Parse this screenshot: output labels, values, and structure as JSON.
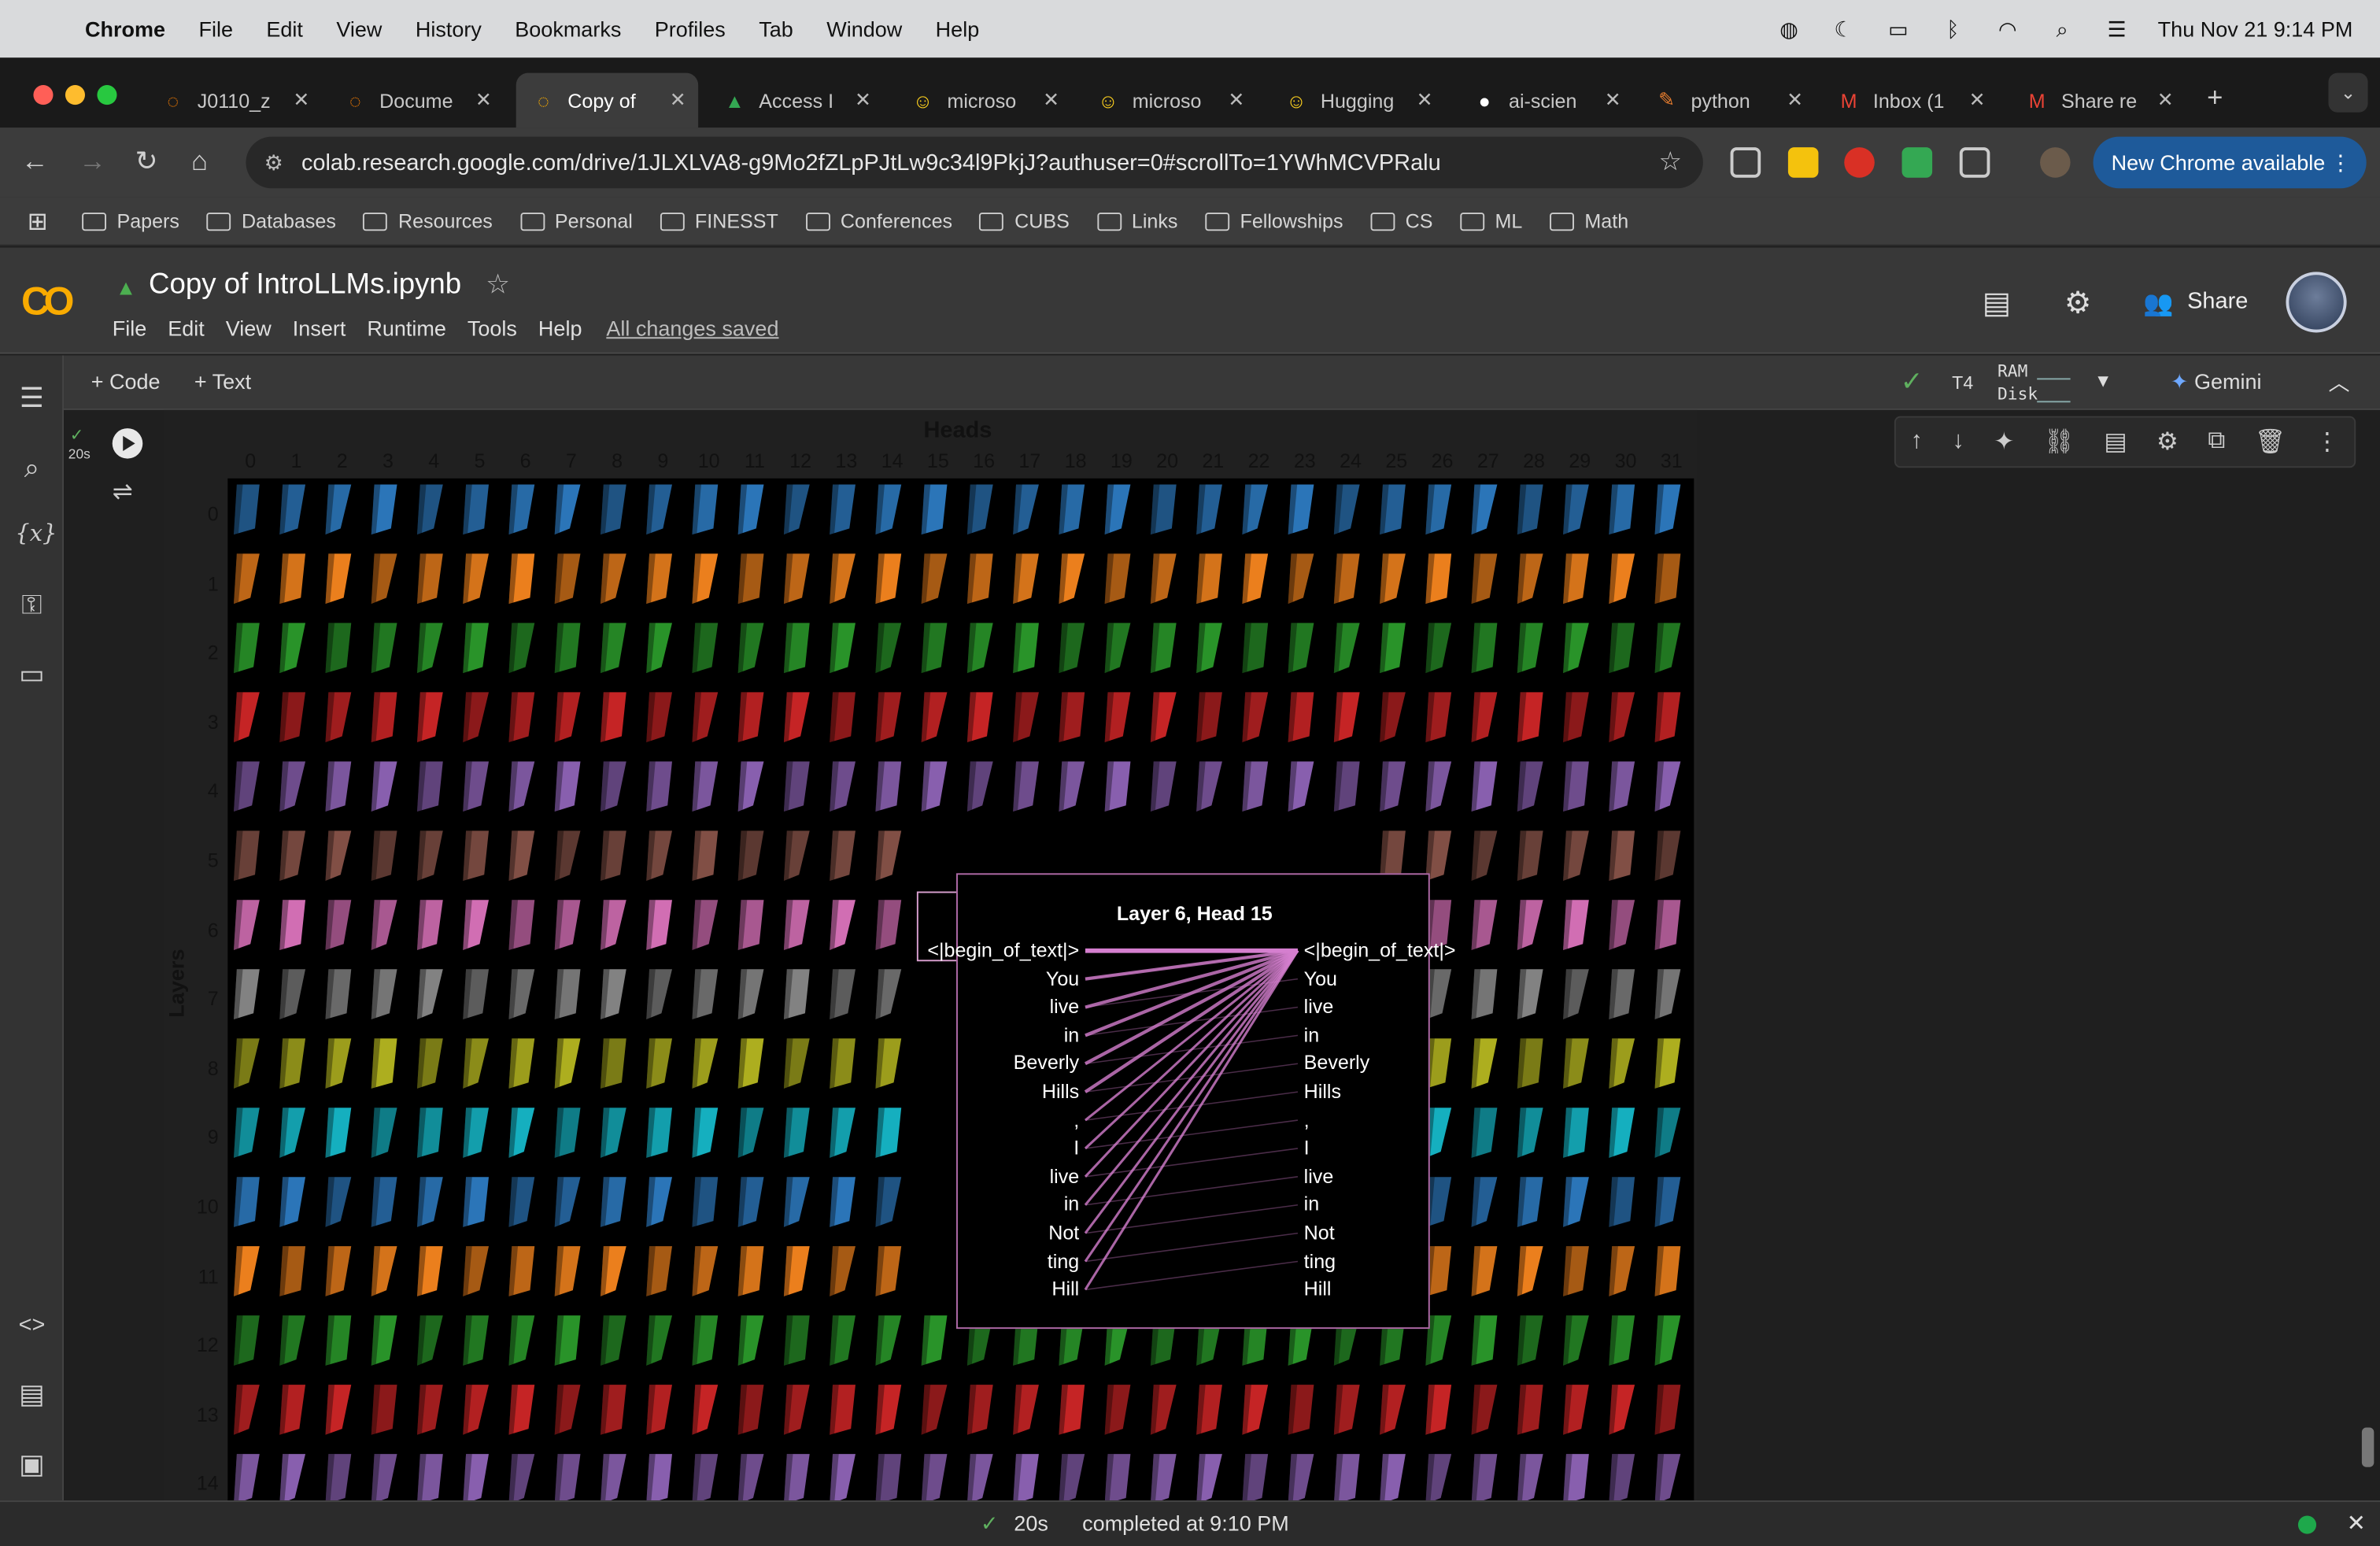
{
  "macos": {
    "app_name": "Chrome",
    "menu": [
      "File",
      "Edit",
      "View",
      "History",
      "Bookmarks",
      "Profiles",
      "Tab",
      "Window",
      "Help"
    ],
    "clock": "Thu Nov 21  9:14 PM"
  },
  "tabs": [
    {
      "label": "J0110_z",
      "icon": "colab-loading-icon",
      "color": "#f57c00"
    },
    {
      "label": "Docume",
      "icon": "colab-loading-icon",
      "color": "#f57c00"
    },
    {
      "label": "Copy of",
      "icon": "colab-icon",
      "color": "#f9ab00",
      "active": true
    },
    {
      "label": "Access I",
      "icon": "drive-icon",
      "color": "#34a853"
    },
    {
      "label": "microso",
      "icon": "huggingface-icon",
      "color": "#ffd21e"
    },
    {
      "label": "microso",
      "icon": "huggingface-icon",
      "color": "#ffd21e"
    },
    {
      "label": "Hugging",
      "icon": "huggingface-icon",
      "color": "#ffd21e"
    },
    {
      "label": "ai-scien",
      "icon": "github-icon",
      "color": "#ffffff"
    },
    {
      "label": "python",
      "icon": "python-icon",
      "color": "#e87d2e"
    },
    {
      "label": "Inbox (1",
      "icon": "gmail-icon",
      "color": "#ea4335"
    },
    {
      "label": "Share re",
      "icon": "gmail-icon",
      "color": "#ea4335"
    }
  ],
  "toolbar": {
    "url": "colab.research.google.com/drive/1JLXLVA8-g9Mo2fZLpPJtLw9c34l9PkjJ?authuser=0#scrollTo=1YWhMCVPRalu",
    "update_label": "New Chrome available"
  },
  "bookmarks": [
    "Papers",
    "Databases",
    "Resources",
    "Personal",
    "FINESST",
    "Conferences",
    "CUBS",
    "Links",
    "Fellowships",
    "CS",
    "ML",
    "Math"
  ],
  "colab": {
    "title": "Copy of IntroLLMs.ipynb",
    "menu": [
      "File",
      "Edit",
      "View",
      "Insert",
      "Runtime",
      "Tools",
      "Help"
    ],
    "saved": "All changes saved",
    "share": "Share",
    "add_code": "+ Code",
    "add_text": "+ Text",
    "runtime": "T4",
    "ram": "RAM",
    "disk": "Disk",
    "gemini": "Gemini",
    "cell_time": "20s"
  },
  "plot": {
    "title": "Heads",
    "ylabel": "Layers",
    "heads": [
      "0",
      "1",
      "2",
      "3",
      "4",
      "5",
      "6",
      "7",
      "8",
      "9",
      "10",
      "11",
      "12",
      "13",
      "14",
      "15",
      "16",
      "17",
      "18",
      "19",
      "20",
      "21",
      "22",
      "23",
      "24",
      "25",
      "26",
      "27",
      "28",
      "29",
      "30",
      "31"
    ],
    "layers": [
      "0",
      "1",
      "2",
      "3",
      "4",
      "5",
      "6",
      "7",
      "8",
      "9",
      "10",
      "11",
      "12",
      "13",
      "14"
    ],
    "layer_colors": [
      "#2f7fc8",
      "#ff8a1f",
      "#2ca02c",
      "#d62728",
      "#9467bd",
      "#8c564b",
      "#e377c2",
      "#8d8d8d",
      "#bcbd22",
      "#17becf",
      "#2f7fc8",
      "#ff8a1f",
      "#2ca02c",
      "#d62728",
      "#9467bd"
    ]
  },
  "popup": {
    "title": "Layer 6, Head 15",
    "tokens": [
      "<|begin_of_text|>",
      "You",
      "live",
      "in",
      "Beverly",
      "Hills",
      ",",
      "I",
      "live",
      "in",
      "Not",
      "ting",
      "Hill"
    ],
    "line_color": "#d57fcf"
  },
  "status": {
    "duration": "20s",
    "message": "completed at 9:10 PM"
  }
}
